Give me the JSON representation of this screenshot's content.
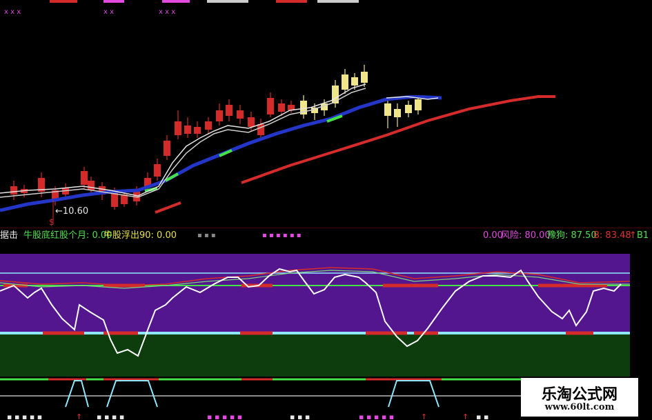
{
  "colors": {
    "background": "#000000",
    "candle_up": "#d42a2a",
    "candle_yellow": "#f1e58a",
    "ma_blue": "#2336c8",
    "ma_red": "#d62b2b",
    "ma_white": "#e6e6e6",
    "osc_purple": "#53168f",
    "osc_green": "#0d3d0d",
    "line_cyan": "#8fe7ff",
    "line_green": "#46e346",
    "label_green": "#4fe04f",
    "label_magenta": "#e24ae2",
    "label_red": "#e03030",
    "label_yellow": "#e8e04a"
  },
  "price_chart": {
    "low_marker": "←10.60"
  },
  "indicator_strip": {
    "left_cut": "据击",
    "bull_red_month": "牛股底红股个月: 0.00",
    "bull_float": "牛股浮出90: 0.00",
    "mid_value": "0.00",
    "risk": "风险: 80.00",
    "elephant": "豫狗: 87.50",
    "b_value": "B: 83.48",
    "b1_cut": "B1"
  },
  "watermark": {
    "title": "乐淘公式网",
    "url": "www.60lt.com"
  }
}
